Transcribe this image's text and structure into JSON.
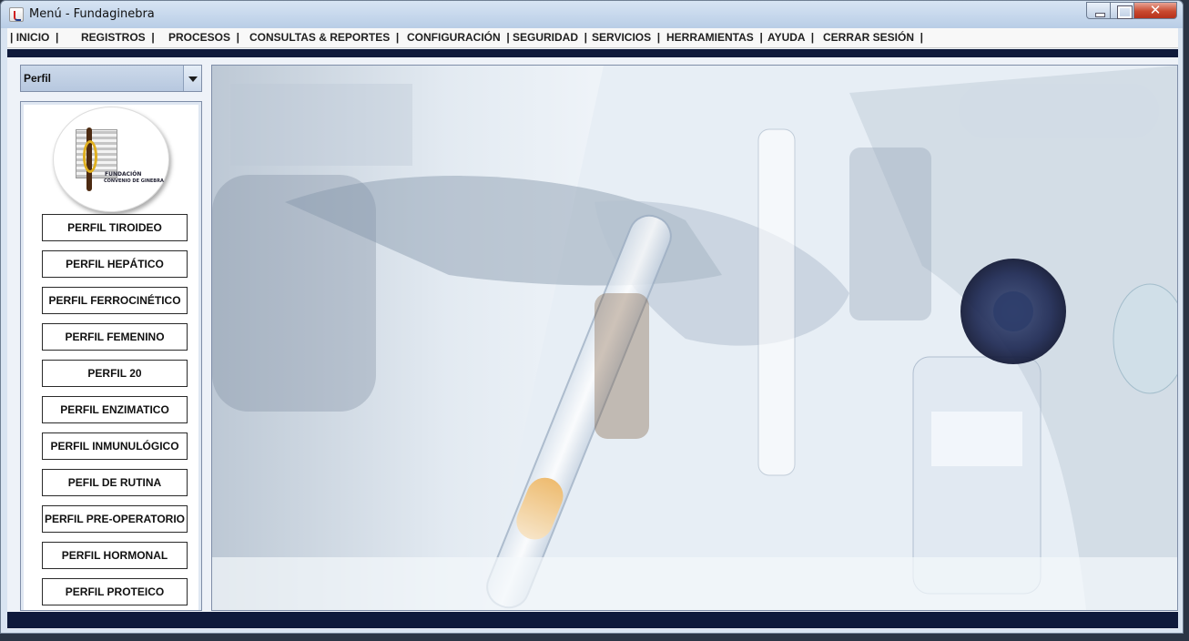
{
  "window": {
    "title": "Menú - Fundaginebra",
    "close_glyph": "✕"
  },
  "menubar": {
    "items": [
      "| INICIO  |",
      "REGISTROS  |",
      "PROCESOS  |",
      "CONSULTAS & REPORTES  |",
      "CONFIGURACIÓN  |",
      "SEGURIDAD  |",
      "SERVICIOS  |",
      "HERRAMIENTAS  |",
      "AYUDA  |",
      "CERRAR SESIÓN  |"
    ]
  },
  "profile_selector": {
    "value": "Perfil"
  },
  "logo": {
    "line1": "FUNDACIÓN",
    "line2": "CONVENIO DE GINEBRA"
  },
  "profiles": [
    "PERFIL TIROIDEO",
    "PERFIL HEPÁTICO",
    "PERFIL FERROCINÉTICO",
    "PERFIL FEMENINO",
    "PERFIL 20",
    "PERFIL ENZIMATICO",
    "PERFIL INMUNULÓGICO",
    "PEFIL DE RUTINA",
    "PERFIL PRE-OPERATORIO",
    "PERFIL HORMONAL",
    "PERFIL PROTEICO"
  ],
  "colors": {
    "navy_band": "#0f1a3b",
    "panel_border": "#7f8ea8",
    "amber_sample": "#f0a850"
  }
}
